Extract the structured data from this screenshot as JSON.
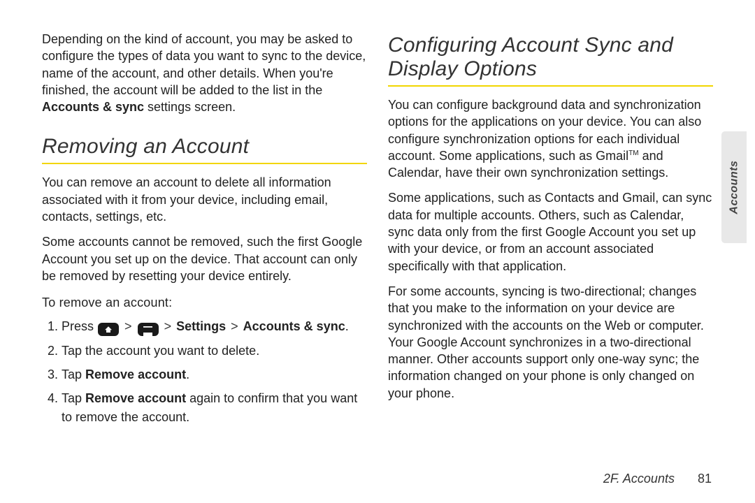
{
  "sideTab": "Accounts",
  "footer": {
    "section": "2F. Accounts",
    "page": "81"
  },
  "left": {
    "intro_pre": "Depending on the kind of account, you may be asked to configure the types of data you want to sync to the device, name of the account, and other details. When you're finished, the account will be added to the list in the ",
    "intro_bold": "Accounts & sync",
    "intro_post": " settings screen.",
    "heading": "Removing an Account",
    "p1": "You can remove an account to delete all information associated with it from your device, including email, contacts, settings, etc.",
    "p2": "Some accounts cannot be removed, such the first Google Account you set up on the device. That account can only be removed by resetting your device entirely.",
    "subhead": "To remove an account:",
    "steps": {
      "s1_pre": "Press ",
      "s1_chev": ">",
      "s1_settings": "Settings",
      "s1_accounts": "Accounts & sync",
      "s1_period": ".",
      "s2": "Tap the account you want to delete.",
      "s3_pre": "Tap ",
      "s3_bold": "Remove account",
      "s3_post": ".",
      "s4_pre": "Tap ",
      "s4_bold": "Remove account",
      "s4_post": " again to confirm that you want to remove the account."
    }
  },
  "right": {
    "heading": "Configuring Account Sync and Display Options",
    "p1_pre": "You can configure background data and synchronization options for the applications on your device. You can also configure synchronization options for each individual account. Some applications, such as Gmail",
    "p1_tm": "TM",
    "p1_post": " and Calendar, have their own synchronization settings.",
    "p2": "Some applications, such as Contacts and Gmail, can sync data for multiple accounts. Others, such as Calendar, sync data only from the first Google Account you set up with your device, or from an account associated specifically with that application.",
    "p3": "For some accounts, syncing is two-directional; changes that you make to the information on your device are synchronized with the accounts on the Web or computer. Your Google Account synchronizes in a two-directional manner. Other accounts support only one-way sync; the information changed on your phone is only changed on your phone."
  }
}
